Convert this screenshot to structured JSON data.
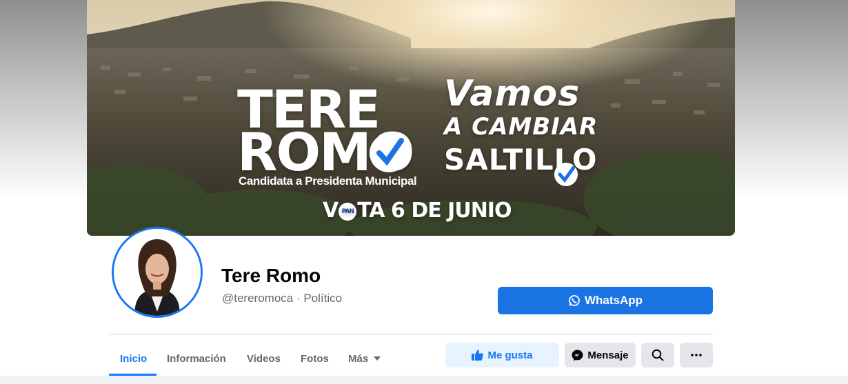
{
  "cover": {
    "name_line1": "TERE",
    "name_line2": "ROMO",
    "subtitle": "Candidata a Presidenta Municipal",
    "slogan_line1": "Vamos",
    "slogan_line2": "A CAMBIAR",
    "slogan_line3": "SALTILLO",
    "vote_prefix": "V",
    "vote_badge": "PAN",
    "vote_suffix": "TA 6 DE JUNIO"
  },
  "profile": {
    "name": "Tere Romo",
    "handle": "@tereromoca · Político"
  },
  "actions": {
    "whatsapp_label": "WhatsApp",
    "like_label": "Me gusta",
    "message_label": "Mensaje"
  },
  "tabs": [
    {
      "label": "Inicio",
      "active": true
    },
    {
      "label": "Información",
      "active": false
    },
    {
      "label": "Videos",
      "active": false
    },
    {
      "label": "Fotos",
      "active": false
    },
    {
      "label": "Más",
      "active": false
    }
  ],
  "colors": {
    "accent": "#1877f2",
    "whatsapp_button": "#1b74e4",
    "like_button_bg": "#e7f3ff",
    "secondary_button_bg": "#e4e6eb"
  }
}
